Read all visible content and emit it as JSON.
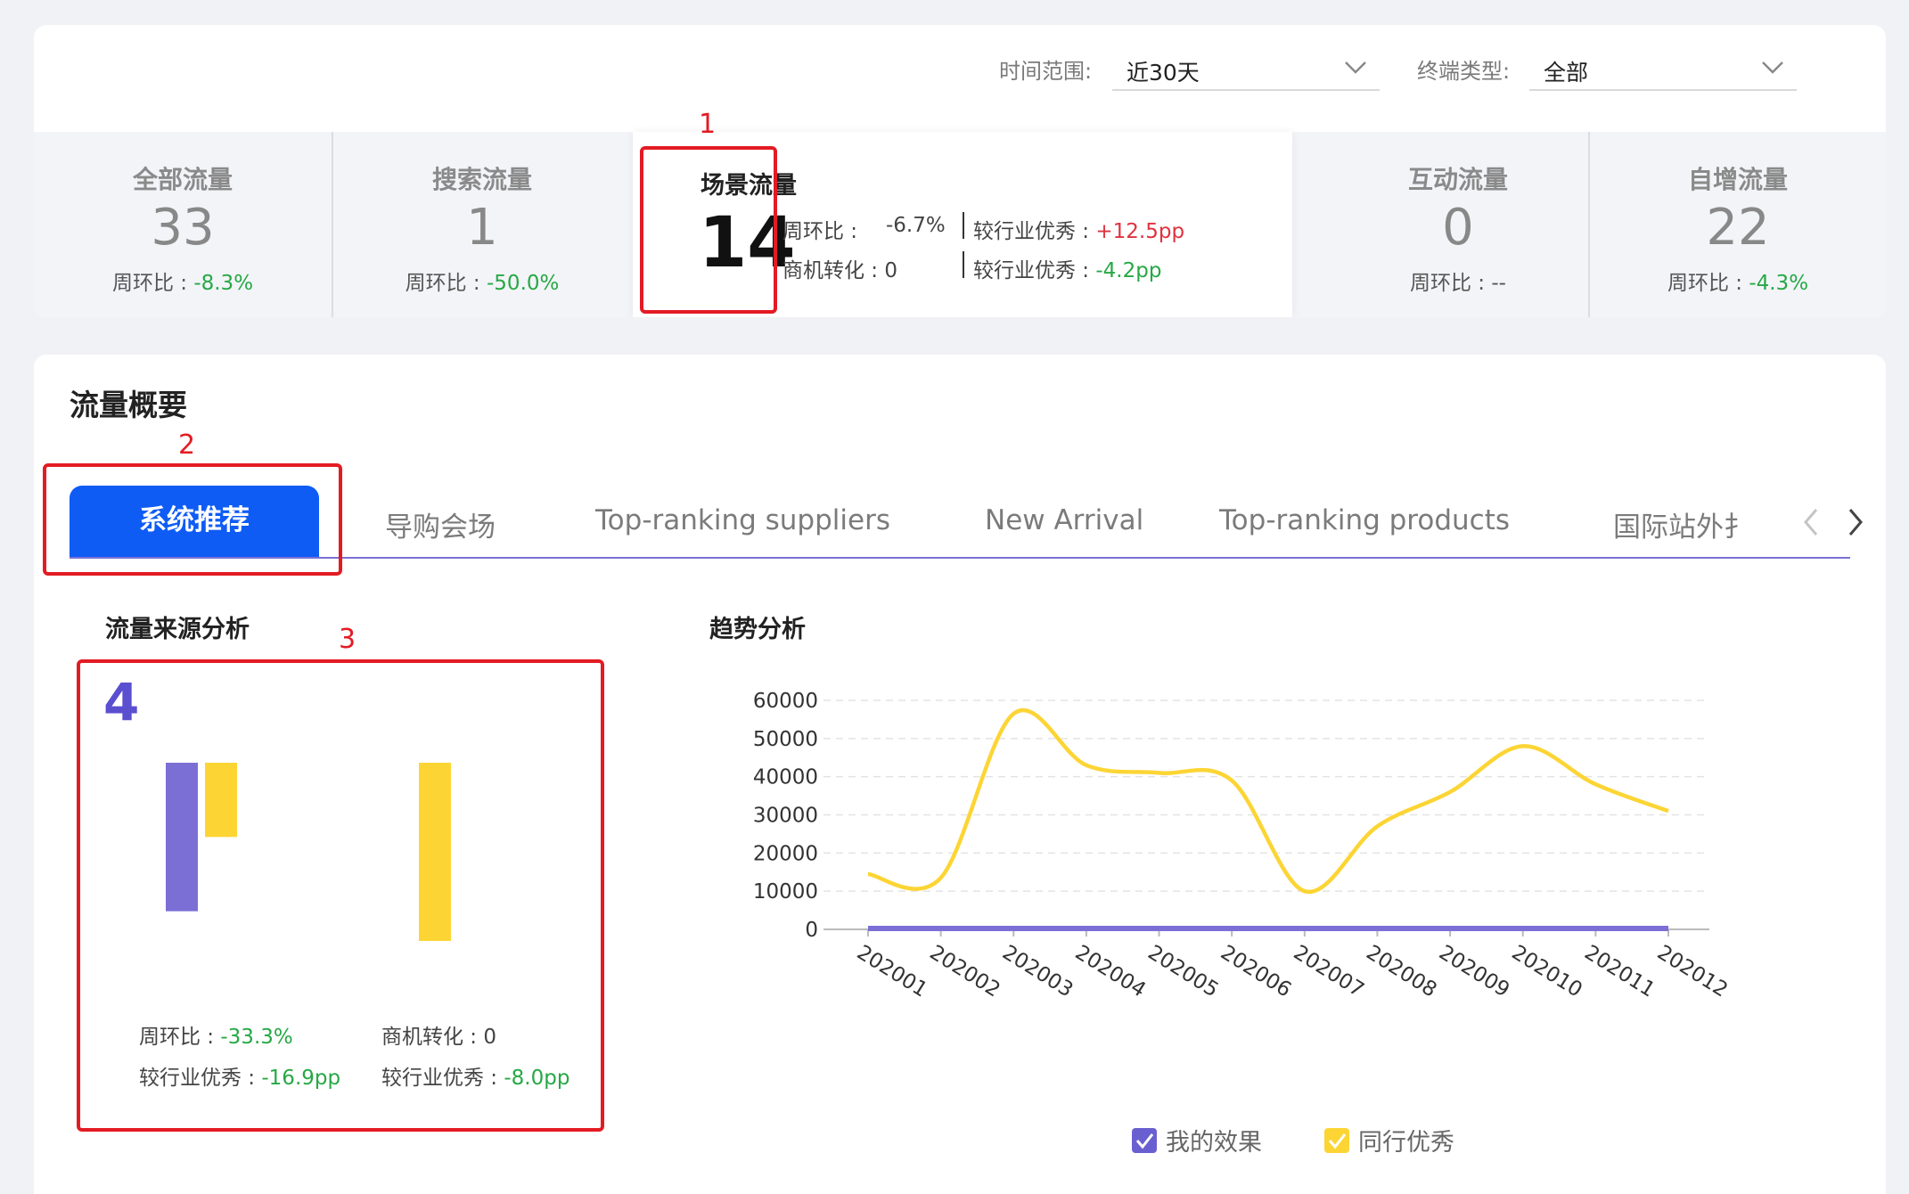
{
  "filters": {
    "time_label": "时间范围:",
    "time_value": "近30天",
    "terminal_label": "终端类型:",
    "terminal_value": "全部"
  },
  "metrics": [
    {
      "title": "全部流量",
      "value": "33",
      "sub_label": "周环比 : ",
      "sub_value": "-8.3%"
    },
    {
      "title": "搜索流量",
      "value": "1",
      "sub_label": "周环比 : ",
      "sub_value": "-50.0%"
    },
    {
      "title": "互动流量",
      "value": "0",
      "sub_label": "周环比 : ",
      "sub_value": "--"
    },
    {
      "title": "自增流量",
      "value": "22",
      "sub_label": "周环比 : ",
      "sub_value": "-4.3%"
    }
  ],
  "active_metric": {
    "title": "场景流量",
    "value": "14",
    "wow_label": "周环比 :",
    "wow_value": "-6.7%",
    "industry_label_1": "较行业优秀 : ",
    "industry_value_1": "+12.5pp",
    "conv_label": "商机转化 : 0",
    "industry_label_2": "较行业优秀 : ",
    "industry_value_2": "-4.2pp"
  },
  "annotations": [
    "1",
    "2",
    "3",
    "4"
  ],
  "overview": {
    "title": "流量概要",
    "tabs": [
      "系统推荐",
      "导购会场",
      "Top-ranking suppliers",
      "New Arrival",
      "Top-ranking products",
      "国际站外扌"
    ]
  },
  "source_analysis": {
    "title": "流量来源分析",
    "wow_label": "周环比 : ",
    "wow_value": "-33.3%",
    "industry_label_1": "较行业优秀 : ",
    "industry_value_1": "-16.9pp",
    "conv_label": "商机转化 : 0",
    "industry_label_2": "较行业优秀 : ",
    "industry_value_2": "-8.0pp"
  },
  "trend": {
    "title": "趋势分析",
    "legend": [
      "我的效果",
      "同行优秀"
    ]
  },
  "colors": {
    "primary": "#0f5cf5",
    "mine": "#7b6fd6",
    "peer": "#fcd535",
    "good": "#26a845",
    "bad": "#e0323f",
    "annotation": "#e31b23"
  },
  "chart_data": [
    {
      "type": "bar",
      "categories": [
        "",
        ""
      ],
      "series": [
        {
          "values": [
            1.0,
            0
          ]
        },
        {
          "values": [
            0.5,
            1.2
          ]
        }
      ]
    },
    {
      "type": "line",
      "categories": [
        "202001",
        "202002",
        "202003",
        "202004",
        "202005",
        "202006",
        "202007",
        "202008",
        "202009",
        "202010",
        "202011",
        "202012"
      ],
      "yticks": [
        0,
        10000,
        20000,
        30000,
        40000,
        50000,
        60000
      ],
      "ylim": [
        0,
        60000
      ],
      "grid": true,
      "legend_position": "bottom",
      "series": [
        {
          "name": "我的效果",
          "values": [
            0,
            0,
            0,
            0,
            0,
            0,
            0,
            0,
            0,
            0,
            0,
            0
          ]
        },
        {
          "name": "同行优秀",
          "values": [
            14500,
            13500,
            56500,
            43000,
            41000,
            39000,
            10000,
            27000,
            36000,
            48000,
            38000,
            31000
          ]
        }
      ]
    }
  ]
}
